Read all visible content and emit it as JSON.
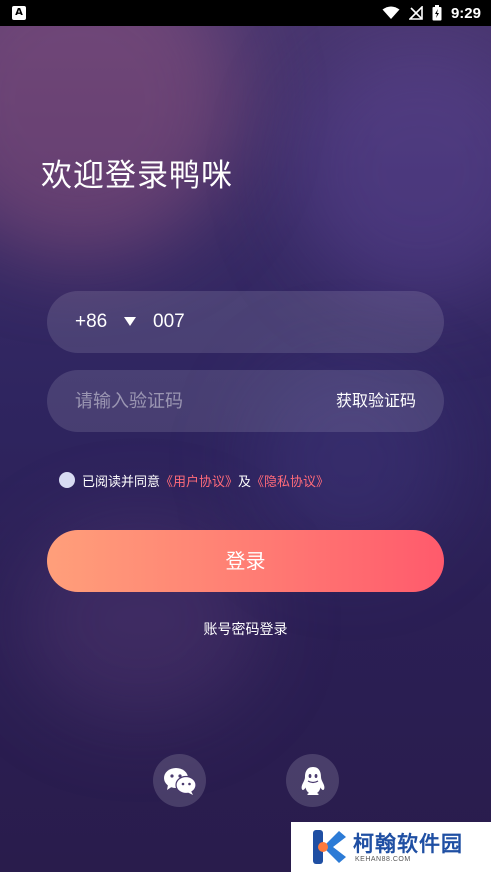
{
  "status_bar": {
    "app_icon_letter": "A",
    "time": "9:29"
  },
  "welcome_title": "欢迎登录鸭咪",
  "phone_field": {
    "country_code": "+86",
    "value": "007"
  },
  "code_field": {
    "placeholder": "请输入验证码",
    "get_code_label": "获取验证码"
  },
  "agreement": {
    "prefix": "已阅读并同意",
    "user_agreement": "《用户协议》",
    "conjunction": "及",
    "privacy_policy": "《隐私协议》",
    "checked": false
  },
  "login_button_label": "登录",
  "password_login_label": "账号密码登录",
  "social_login": {
    "wechat_icon": "wechat-icon",
    "qq_icon": "qq-icon"
  },
  "watermark": {
    "name": "柯翰软件园",
    "sub": "KEHAN88.COM"
  },
  "colors": {
    "accent_link": "#ff6b7a",
    "button_gradient_start": "#ff9f7a",
    "button_gradient_end": "#ff5a6c",
    "background": "#2b1f55"
  }
}
